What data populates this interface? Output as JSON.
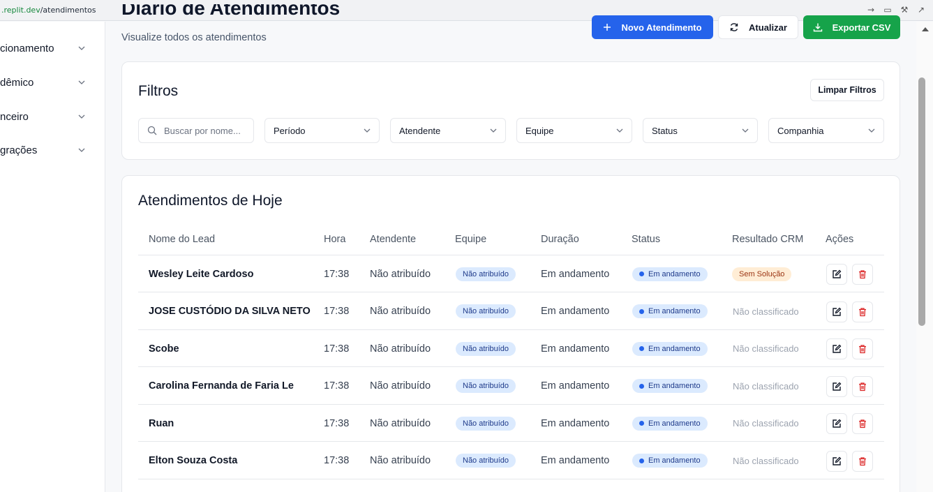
{
  "browser": {
    "url_prefix": ".replit.dev",
    "url_path": "/atendimentos"
  },
  "sidebar": {
    "items": [
      {
        "label": "cionamento"
      },
      {
        "label": "dêmico"
      },
      {
        "label": "nceiro"
      },
      {
        "label": "grações"
      }
    ]
  },
  "header": {
    "title": "Diário de Atendimentos",
    "subtitle": "Visualize todos os atendimentos",
    "new_label": "Novo Atendimento",
    "refresh_label": "Atualizar",
    "export_label": "Exportar CSV"
  },
  "filters": {
    "title": "Filtros",
    "clear_label": "Limpar Filtros",
    "search_placeholder": "Buscar por nome...",
    "period": "Período",
    "attendant": "Atendente",
    "team": "Equipe",
    "status": "Status",
    "company": "Companhia"
  },
  "table": {
    "title": "Atendimentos de Hoje",
    "columns": [
      "Nome do Lead",
      "Hora",
      "Atendente",
      "Equipe",
      "Duração",
      "Status",
      "Resultado CRM",
      "Ações"
    ],
    "rows": [
      {
        "name": "Wesley Leite Cardoso",
        "time": "17:38",
        "attendant": "Não atribuído",
        "team": "Não atribuído",
        "duration": "Em andamento",
        "status": "Em andamento",
        "crm": "Sem Solução"
      },
      {
        "name": "JOSE CUSTÓDIO DA SILVA NETO",
        "time": "17:38",
        "attendant": "Não atribuído",
        "team": "Não atribuído",
        "duration": "Em andamento",
        "status": "Em andamento",
        "crm": "Não classificado"
      },
      {
        "name": "Scobe",
        "time": "17:38",
        "attendant": "Não atribuído",
        "team": "Não atribuído",
        "duration": "Em andamento",
        "status": "Em andamento",
        "crm": "Não classificado"
      },
      {
        "name": "Carolina Fernanda de Faria Le",
        "time": "17:38",
        "attendant": "Não atribuído",
        "team": "Não atribuído",
        "duration": "Em andamento",
        "status": "Em andamento",
        "crm": "Não classificado"
      },
      {
        "name": "Ruan",
        "time": "17:38",
        "attendant": "Não atribuído",
        "team": "Não atribuído",
        "duration": "Em andamento",
        "status": "Em andamento",
        "crm": "Não classificado"
      },
      {
        "name": "Elton Souza Costa",
        "time": "17:38",
        "attendant": "Não atribuído",
        "team": "Não atribuído",
        "duration": "Em andamento",
        "status": "Em andamento",
        "crm": "Não classificado"
      }
    ]
  },
  "colors": {
    "primary": "#2563eb",
    "success": "#16a34a",
    "danger": "#dc2626",
    "badge_blue_bg": "#dbeafe",
    "badge_orange_bg": "#ffedd5"
  },
  "icons": {
    "new": "plus-icon",
    "refresh": "refresh-icon",
    "export": "download-icon",
    "search": "search-icon",
    "dropdown": "chevron-down-icon",
    "edit": "edit-icon",
    "delete": "trash-icon"
  }
}
